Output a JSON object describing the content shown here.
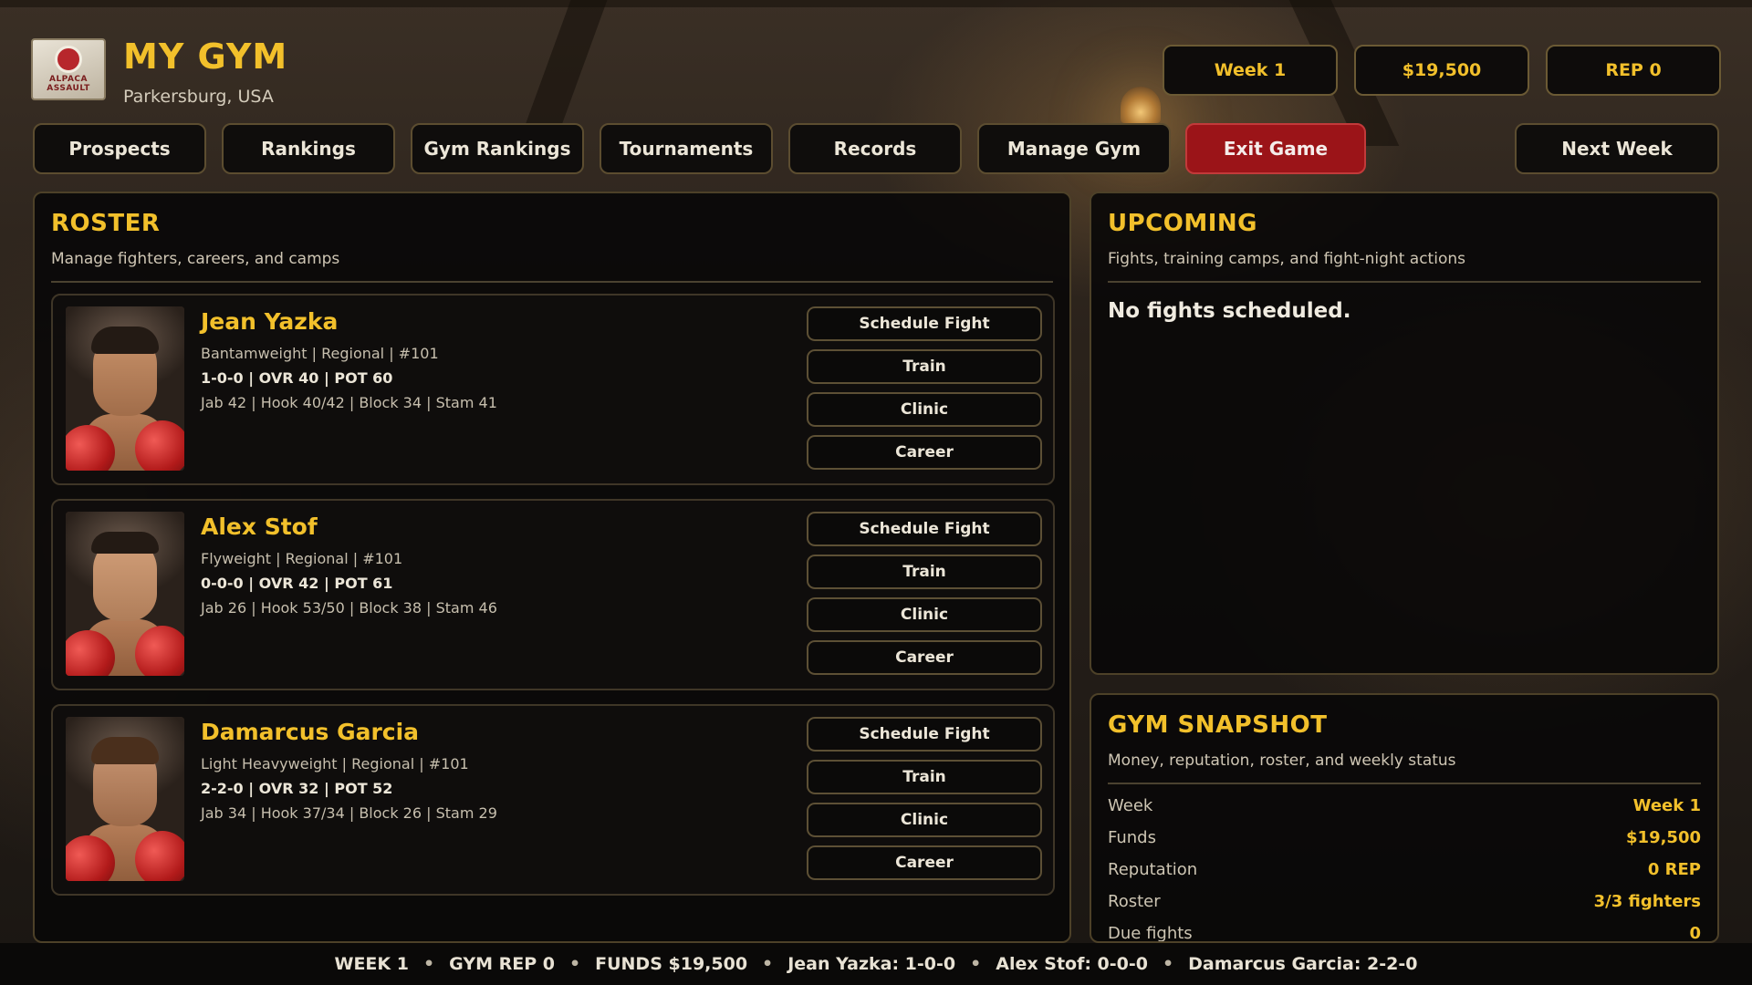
{
  "header": {
    "title": "MY GYM",
    "location": "Parkersburg, USA",
    "logo_text": "ALPACA ASSAULT",
    "stats": {
      "week": "Week 1",
      "funds": "$19,500",
      "rep": "REP 0"
    }
  },
  "nav": {
    "prospects": "Prospects",
    "rankings": "Rankings",
    "gym_rankings": "Gym Rankings",
    "tournaments": "Tournaments",
    "records": "Records",
    "manage_gym": "Manage Gym",
    "exit_game": "Exit Game",
    "next_week": "Next Week"
  },
  "roster": {
    "title": "ROSTER",
    "subtitle": "Manage fighters, careers, and camps",
    "actions": {
      "schedule": "Schedule Fight",
      "train": "Train",
      "clinic": "Clinic",
      "career": "Career"
    },
    "fighters": [
      {
        "name": "Jean Yazka",
        "info": "Bantamweight | Regional | #101",
        "record": "1-0-0  |  OVR 40  |  POT 60",
        "skills": "Jab 42 | Hook 40/42 | Block 34 | Stam 41"
      },
      {
        "name": "Alex Stof",
        "info": "Flyweight | Regional | #101",
        "record": "0-0-0  |  OVR 42  |  POT 61",
        "skills": "Jab 26 | Hook 53/50 | Block 38 | Stam 46"
      },
      {
        "name": "Damarcus Garcia",
        "info": "Light Heavyweight | Regional | #101",
        "record": "2-2-0  |  OVR 32  |  POT 52",
        "skills": "Jab 34 | Hook 37/34 | Block 26 | Stam 29"
      }
    ]
  },
  "upcoming": {
    "title": "UPCOMING",
    "subtitle": "Fights, training camps, and fight-night actions",
    "empty": "No fights scheduled."
  },
  "snapshot": {
    "title": "GYM SNAPSHOT",
    "subtitle": "Money, reputation, roster, and weekly status",
    "rows": [
      {
        "key": "Week",
        "value": "Week 1"
      },
      {
        "key": "Funds",
        "value": "$19,500"
      },
      {
        "key": "Reputation",
        "value": "0 REP"
      },
      {
        "key": "Roster",
        "value": "3/3 fighters"
      },
      {
        "key": "Due fights",
        "value": "0"
      }
    ]
  },
  "status_bar": {
    "items": [
      "WEEK 1",
      "GYM REP 0",
      "FUNDS $19,500",
      "Jean Yazka: 1-0-0",
      "Alex Stof: 0-0-0",
      "Damarcus Garcia: 2-2-0"
    ],
    "separator": "•"
  }
}
